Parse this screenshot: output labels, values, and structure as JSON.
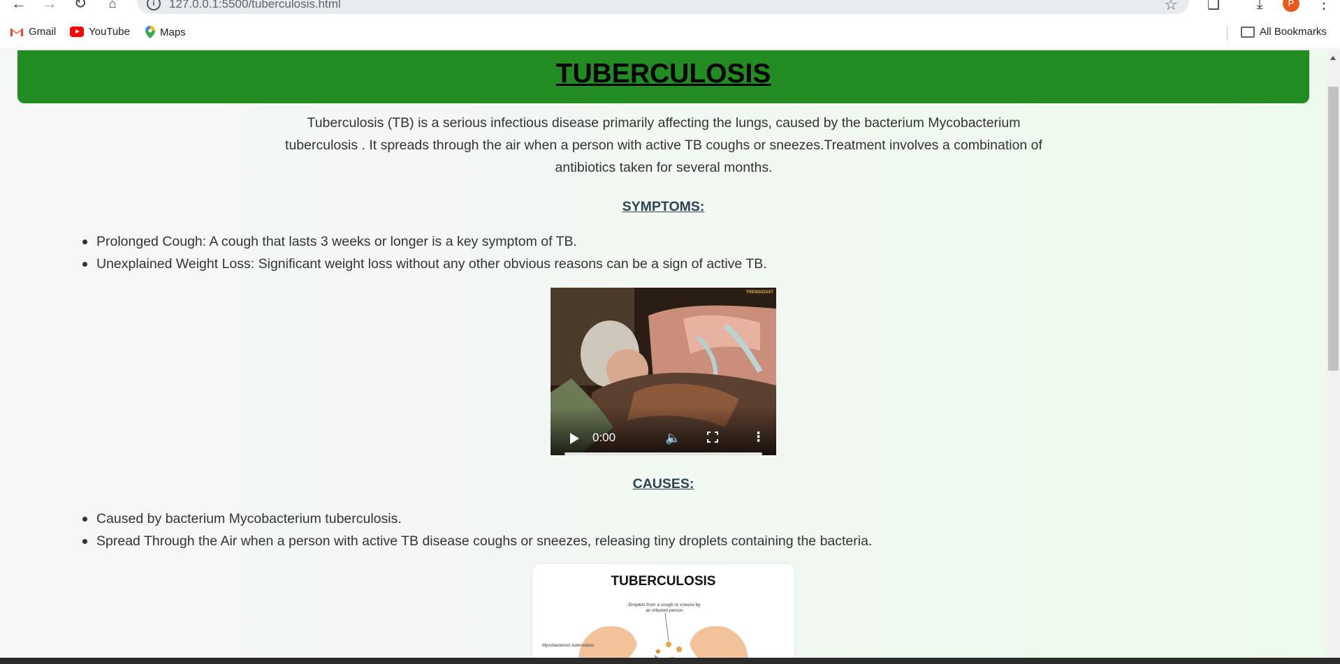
{
  "browser": {
    "url": "127.0.0.1:5500/tuberculosis.html",
    "profile_initial": "P",
    "bookmarks": [
      {
        "label": "Gmail",
        "icon": "gmail-icon"
      },
      {
        "label": "YouTube",
        "icon": "youtube-icon"
      },
      {
        "label": "Maps",
        "icon": "maps-icon"
      }
    ],
    "all_bookmarks_label": "All Bookmarks"
  },
  "page": {
    "title": "TUBERCULOSIS",
    "intro": "Tuberculosis (TB) is a serious infectious disease primarily affecting the lungs, caused by the bacterium Mycobacterium tuberculosis . It spreads through the air when a person with active TB coughs or sneezes.Treatment involves a combination of antibiotics taken for several months.",
    "symptoms_heading": "SYMPTOMS:",
    "symptoms": [
      "Prolonged Cough: A cough that lasts 3 weeks or longer is a key symptom of TB.",
      "Unexplained Weight Loss: Significant weight loss without any other obvious reasons can be a sign of active TB."
    ],
    "video": {
      "time": "0:00",
      "watermark": "TRENDIZISST",
      "progress": 0
    },
    "causes_heading": "CAUSES:",
    "causes": [
      "Caused by bacterium Mycobacterium tuberculosis.",
      "Spread Through the Air when a person with active TB disease coughs or sneezes, releasing tiny droplets containing the bacteria."
    ],
    "infographic": {
      "title": "TUBERCULOSIS",
      "caption": "Droplets from a cough or sneeze by an infected person",
      "label": "Mycobacterium tuberculosis"
    }
  },
  "colors": {
    "header_band": "#228b22",
    "section_heading": "#2d4550",
    "body_text": "#333333",
    "background_tint": "#ecfbec"
  }
}
